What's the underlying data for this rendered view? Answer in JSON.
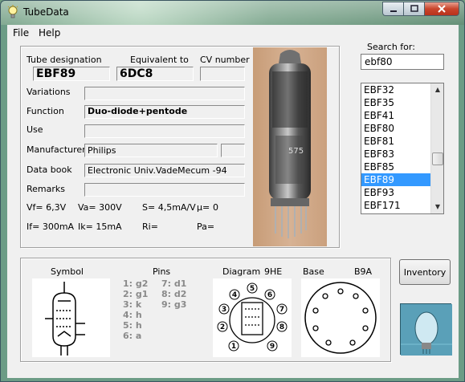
{
  "window": {
    "title": "TubeData",
    "minimize_icon": "minimize-icon",
    "maximize_icon": "maximize-icon",
    "close_icon": "close-icon"
  },
  "menu": {
    "file": "File",
    "help": "Help"
  },
  "details": {
    "tube_designation_label": "Tube designation",
    "equivalent_label": "Equivalent to",
    "cv_label": "CV number",
    "tube_designation": "EBF89",
    "equivalent": "6DC8",
    "cv_number": "",
    "variations_label": "Variations",
    "variations": "",
    "function_label": "Function",
    "function": "Duo-diode+pentode",
    "use_label": "Use",
    "use": "",
    "manufacturer_label": "Manufacturer",
    "manufacturer": "Philips",
    "manufacturer_extra": "",
    "databook_label": "Data book",
    "databook": "Electronic Univ.VadeMecum -94",
    "remarks_label": "Remarks",
    "remarks": ""
  },
  "specs": {
    "vf": "Vf= 6,3V",
    "va": "Va=  300V",
    "s": "S= 4,5mA/V",
    "mu": "µ=",
    "mu_value": "0",
    "if": "If= 300mA",
    "ik": "Ik=   15mA",
    "ri": "Ri=",
    "pa": "Pa="
  },
  "photo": {
    "print": "575"
  },
  "search": {
    "label": "Search for:",
    "value": "ebf80",
    "results": [
      "EBF32",
      "EBF35",
      "EBF41",
      "EBF80",
      "EBF81",
      "EBF83",
      "EBF85",
      "EBF89",
      "EBF93",
      "EBF171"
    ],
    "selected": "EBF89"
  },
  "bottom": {
    "symbol_label": "Symbol",
    "pins_label": "Pins",
    "diagram_label": "Diagram",
    "diagram_code": "9HE",
    "base_label": "Base",
    "base_code": "B9A",
    "pins_left": [
      "1: g2",
      "2: g1",
      "3: k",
      "4: h",
      "5: h",
      "6: a"
    ],
    "pins_right": [
      "7: d1",
      "8: d2",
      "9: g3"
    ]
  },
  "inventory_button": "Inventory",
  "colors": {
    "selection": "#3399ff",
    "window_bg": "#f0f0f0"
  }
}
